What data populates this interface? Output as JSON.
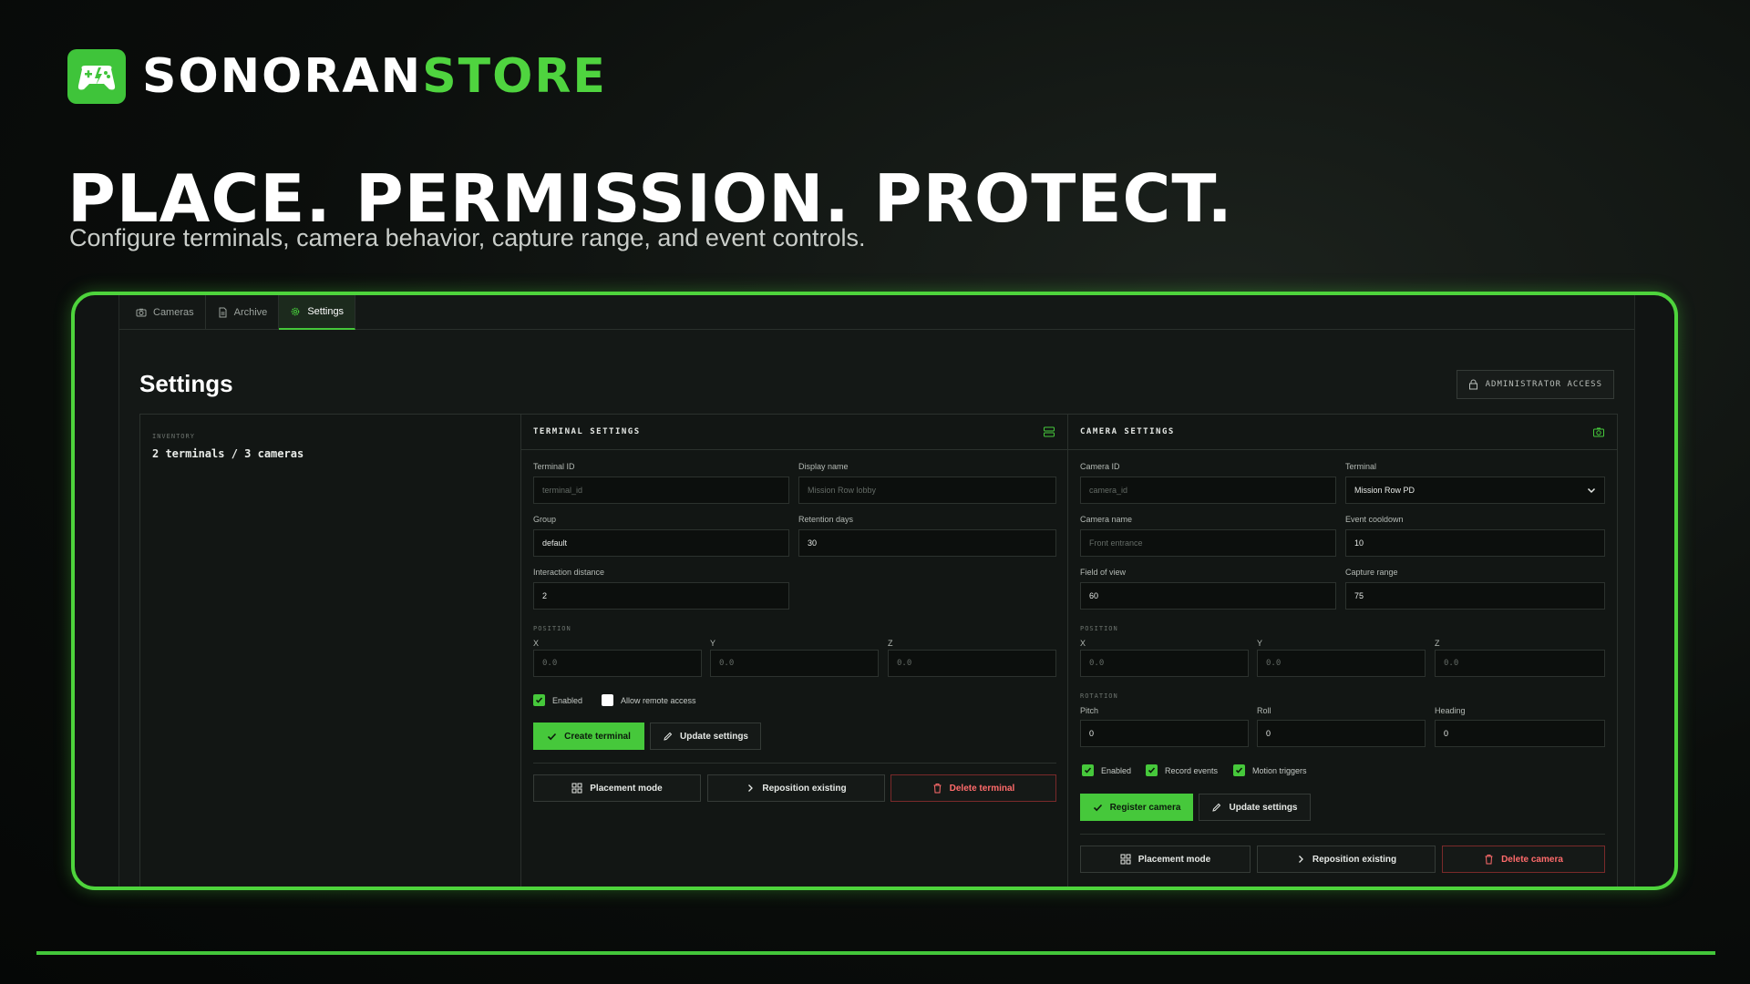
{
  "brand": {
    "name_white": "SONORAN",
    "name_green": "STORE"
  },
  "hero": {
    "headline": "PLACE. PERMISSION. PROTECT.",
    "subline": "Configure terminals, camera behavior, capture range, and event controls."
  },
  "tabs": [
    {
      "label": "Cameras",
      "icon": "camera-icon",
      "active": false
    },
    {
      "label": "Archive",
      "icon": "document-icon",
      "active": false
    },
    {
      "label": "Settings",
      "icon": "gear-icon",
      "active": true
    }
  ],
  "page": {
    "title": "Settings",
    "admin_label": "ADMINISTRATOR ACCESS"
  },
  "inventory": {
    "label": "INVENTORY",
    "value": "2 terminals / 3 cameras"
  },
  "terminal": {
    "title": "TERMINAL SETTINGS",
    "terminal_id": {
      "label": "Terminal ID",
      "placeholder": "terminal_id"
    },
    "display_name": {
      "label": "Display name",
      "placeholder": "Mission Row lobby"
    },
    "group": {
      "label": "Group",
      "value": "default"
    },
    "retention": {
      "label": "Retention days",
      "value": "30"
    },
    "interaction": {
      "label": "Interaction distance",
      "value": "2"
    },
    "position_label": "POSITION",
    "x": {
      "label": "X",
      "placeholder": "0.0"
    },
    "y": {
      "label": "Y",
      "placeholder": "0.0"
    },
    "z": {
      "label": "Z",
      "placeholder": "0.0"
    },
    "enabled": {
      "label": "Enabled",
      "checked": true
    },
    "remote": {
      "label": "Allow remote access",
      "checked": false
    },
    "create_btn": "Create terminal",
    "update_btn": "Update settings",
    "placement_btn": "Placement mode",
    "reposition_btn": "Reposition existing",
    "delete_btn": "Delete terminal"
  },
  "camera": {
    "title": "CAMERA SETTINGS",
    "camera_id": {
      "label": "Camera ID",
      "placeholder": "camera_id"
    },
    "terminal": {
      "label": "Terminal",
      "value": "Mission Row PD"
    },
    "camera_name": {
      "label": "Camera name",
      "placeholder": "Front entrance"
    },
    "cooldown": {
      "label": "Event cooldown",
      "value": "10"
    },
    "fov": {
      "label": "Field of view",
      "value": "60"
    },
    "capture": {
      "label": "Capture range",
      "value": "75"
    },
    "position_label": "POSITION",
    "x": {
      "label": "X",
      "placeholder": "0.0"
    },
    "y": {
      "label": "Y",
      "placeholder": "0.0"
    },
    "z": {
      "label": "Z",
      "placeholder": "0.0"
    },
    "rotation_label": "ROTATION",
    "pitch": {
      "label": "Pitch",
      "value": "0"
    },
    "roll": {
      "label": "Roll",
      "value": "0"
    },
    "heading": {
      "label": "Heading",
      "value": "0"
    },
    "enabled": {
      "label": "Enabled",
      "checked": true
    },
    "record": {
      "label": "Record events",
      "checked": true
    },
    "motion": {
      "label": "Motion triggers",
      "checked": true
    },
    "register_btn": "Register camera",
    "update_btn": "Update settings",
    "placement_btn": "Placement mode",
    "reposition_btn": "Reposition existing",
    "delete_btn": "Delete camera"
  },
  "colors": {
    "accent": "#46c83b",
    "danger": "#ff6b6b",
    "background": "#0b0e0c"
  }
}
